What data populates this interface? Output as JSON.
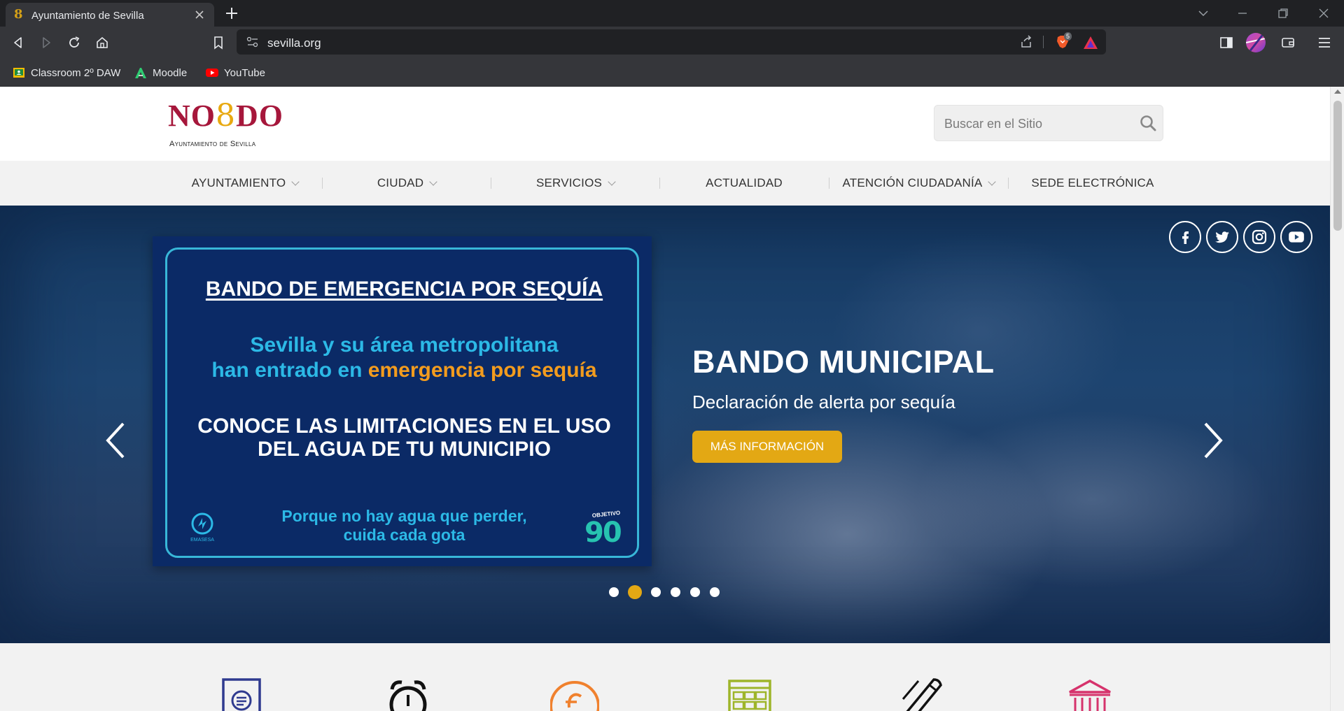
{
  "browser": {
    "tab_title": "Ayuntamiento de Sevilla",
    "url": "sevilla.org",
    "shields_count": "5",
    "bookmarks": [
      {
        "label": "Classroom 2º DAW",
        "icon": "google-classroom-icon"
      },
      {
        "label": "Moodle",
        "icon": "moodle-icon"
      },
      {
        "label": "YouTube",
        "icon": "youtube-icon"
      }
    ]
  },
  "site": {
    "logo_text_left": "NO",
    "logo_text_mid": "8",
    "logo_text_right": "DO",
    "logo_sub": "Ayuntamiento de Sevilla",
    "search_placeholder": "Buscar en el Sitio",
    "nav": [
      {
        "label": "AYUNTAMIENTO",
        "dropdown": true
      },
      {
        "label": "CIUDAD",
        "dropdown": true
      },
      {
        "label": "SERVICIOS",
        "dropdown": true
      },
      {
        "label": "ACTUALIDAD",
        "dropdown": false
      },
      {
        "label": "ATENCIÓN CIUDADANÍA",
        "dropdown": true
      },
      {
        "label": "SEDE ELECTRÓNICA",
        "dropdown": false
      }
    ]
  },
  "hero": {
    "poster": {
      "title": "BANDO DE EMERGENCIA POR SEQUÍA",
      "line1": "Sevilla y su área metropolitana",
      "line2_a": "han entrado en ",
      "line2_b": "emergencia por sequía",
      "line3": "CONOCE LAS LIMITACIONES EN EL USO",
      "line4": "DEL AGUA DE TU MUNICIPIO",
      "foot1": "Porque no hay agua que perder,",
      "foot2": "cuida cada gota",
      "emasesa": "EMASESA",
      "objetivo_label": "OBJETIVO",
      "objetivo_num": "90"
    },
    "title": "BANDO MUNICIPAL",
    "subtitle": "Declaración de alerta por sequía",
    "button": "MÁS INFORMACIÓN",
    "slides_total": 6,
    "active_slide": 2,
    "social": [
      "facebook-icon",
      "twitter-icon",
      "instagram-icon",
      "youtube-icon"
    ]
  },
  "colors": {
    "brand_red": "#a6173b",
    "brand_gold": "#e8a911",
    "button_gold": "#e3a814",
    "poster_cyan": "#2cb9e6",
    "poster_orange": "#f39c1e"
  }
}
